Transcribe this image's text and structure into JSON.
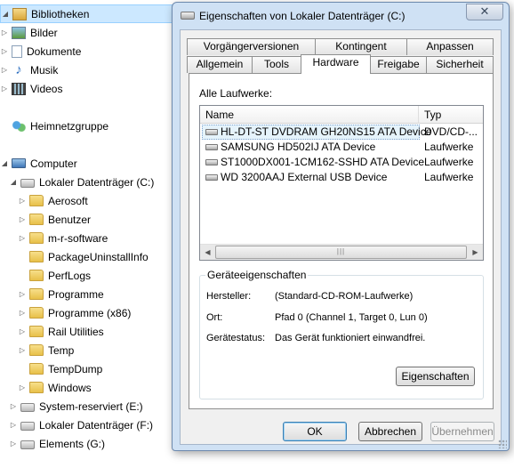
{
  "explorer": {
    "libraries": {
      "label": "Bibliotheken"
    },
    "library_items": [
      "Bilder",
      "Dokumente",
      "Musik",
      "Videos"
    ],
    "homegroup": {
      "label": "Heimnetzgruppe"
    },
    "computer": {
      "label": "Computer"
    },
    "drive_c": {
      "label": "Lokaler Datenträger (C:)"
    },
    "folders": [
      "Aerosoft",
      "Benutzer",
      "m-r-software",
      "PackageUninstallInfo",
      "PerfLogs",
      "Programme",
      "Programme (x86)",
      "Rail Utilities",
      "Temp",
      "TempDump",
      "Windows"
    ],
    "other_drives": [
      "System-reserviert (E:)",
      "Lokaler Datenträger (F:)",
      "Elements (G:)"
    ]
  },
  "dialog": {
    "title": "Eigenschaften von Lokaler Datenträger (C:)",
    "close_glyph": "✕",
    "tabs_back": [
      "Vorgängerversionen",
      "Kontingent",
      "Anpassen"
    ],
    "tabs_front": [
      "Allgemein",
      "Tools",
      "Hardware",
      "Freigabe",
      "Sicherheit"
    ],
    "active_tab": "Hardware",
    "all_drives_label": "Alle Laufwerke:",
    "columns": {
      "name": "Name",
      "type": "Typ"
    },
    "devices": [
      {
        "name": "HL-DT-ST DVDRAM GH20NS15 ATA Device",
        "type": "DVD/CD-..."
      },
      {
        "name": "SAMSUNG HD502IJ ATA Device",
        "type": "Laufwerke"
      },
      {
        "name": "ST1000DX001-1CM162-SSHD ATA Device",
        "type": "Laufwerke"
      },
      {
        "name": "WD 3200AAJ External USB Device",
        "type": "Laufwerke"
      }
    ],
    "selected_device_index": 0,
    "device_props": {
      "legend": "Geräteeigenschaften",
      "manufacturer_label": "Hersteller:",
      "manufacturer_value": "(Standard-CD-ROM-Laufwerke)",
      "location_label": "Ort:",
      "location_value": "Pfad 0 (Channel 1, Target 0, Lun 0)",
      "status_label": "Gerätestatus:",
      "status_value": "Das Gerät funktioniert einwandfrei.",
      "properties_button": "Eigenschaften"
    },
    "buttons": {
      "ok": "OK",
      "cancel": "Abbrechen",
      "apply": "Übernehmen"
    },
    "apply_enabled": false
  },
  "colors": {
    "dialog_frame": "#cfe1f4",
    "selection": "#cce8ff",
    "button_focus": "#3c7fb1"
  }
}
